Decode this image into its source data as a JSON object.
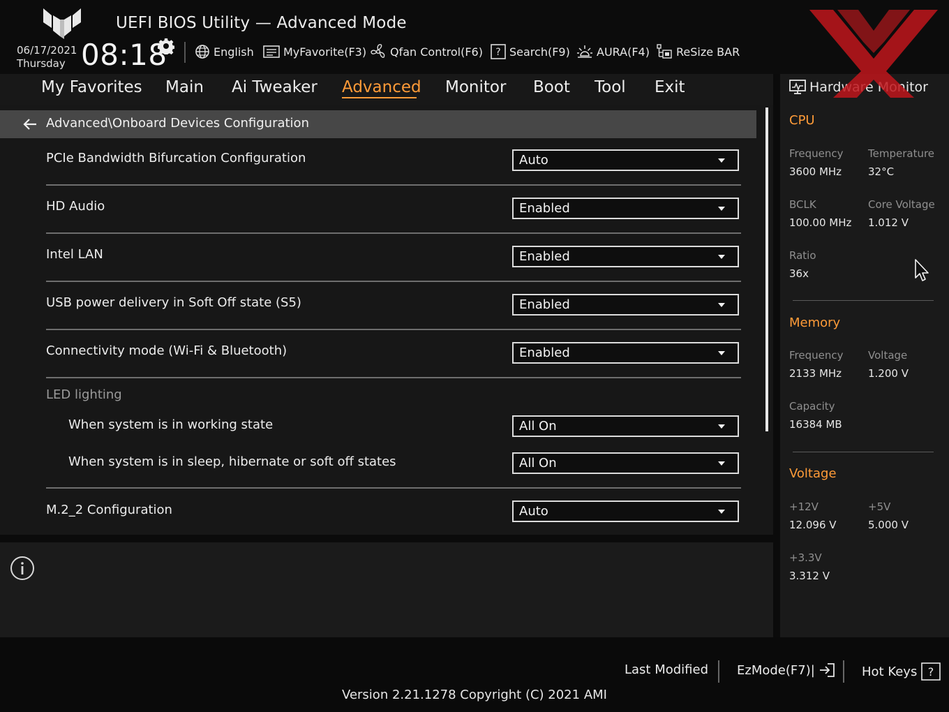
{
  "header": {
    "title": "UEFI BIOS Utility — Advanced Mode",
    "date": "06/17/2021",
    "day": "Thursday",
    "time": "08:18",
    "toolbar": [
      {
        "label": "English",
        "icon": "globe-icon"
      },
      {
        "label": "MyFavorite(F3)",
        "icon": "favorite-list-icon"
      },
      {
        "label": "Qfan Control(F6)",
        "icon": "fan-icon"
      },
      {
        "label": "Search(F9)",
        "icon": "help-search-icon"
      },
      {
        "label": "AURA(F4)",
        "icon": "aura-light-icon"
      },
      {
        "label": "ReSize BAR",
        "icon": "resize-bar-icon"
      }
    ]
  },
  "nav": {
    "tabs": [
      {
        "label": "My Favorites"
      },
      {
        "label": "Main"
      },
      {
        "label": "Ai Tweaker"
      },
      {
        "label": "Advanced",
        "active": true
      },
      {
        "label": "Monitor"
      },
      {
        "label": "Boot"
      },
      {
        "label": "Tool"
      },
      {
        "label": "Exit"
      }
    ]
  },
  "main": {
    "breadcrumb": "Advanced\\Onboard Devices Configuration",
    "settings": [
      {
        "label": "PCIe Bandwidth Bifurcation Configuration",
        "value": "Auto"
      },
      {
        "label": "HD Audio",
        "value": "Enabled"
      },
      {
        "label": "Intel LAN",
        "value": "Enabled"
      },
      {
        "label": "USB power delivery in Soft Off state (S5)",
        "value": "Enabled"
      },
      {
        "label": "Connectivity mode (Wi-Fi & Bluetooth)",
        "value": "Enabled"
      }
    ],
    "led_group": {
      "label": "LED lighting",
      "settings": [
        {
          "label": "When system is in working state",
          "value": "All On"
        },
        {
          "label": "When system is in sleep, hibernate or soft off states",
          "value": "All On"
        }
      ]
    },
    "m2_setting": {
      "label": "M.2_2 Configuration",
      "value": "Auto"
    }
  },
  "hw_monitor": {
    "title": "Hardware Monitor",
    "cpu": {
      "title": "CPU",
      "frequency_label": "Frequency",
      "frequency": "3600 MHz",
      "temperature_label": "Temperature",
      "temperature": "32°C",
      "bclk_label": "BCLK",
      "bclk": "100.00 MHz",
      "core_voltage_label": "Core Voltage",
      "core_voltage": "1.012 V",
      "ratio_label": "Ratio",
      "ratio": "36x"
    },
    "memory": {
      "title": "Memory",
      "frequency_label": "Frequency",
      "frequency": "2133 MHz",
      "voltage_label": "Voltage",
      "voltage": "1.200 V",
      "capacity_label": "Capacity",
      "capacity": "16384 MB"
    },
    "voltage": {
      "title": "Voltage",
      "v12_label": "+12V",
      "v12": "12.096 V",
      "v5_label": "+5V",
      "v5": "5.000 V",
      "v33_label": "+3.3V",
      "v33": "3.312 V"
    }
  },
  "footer": {
    "last_modified": "Last Modified",
    "ezmode": "EzMode(F7)|",
    "hot_keys": "Hot Keys",
    "hot_keys_glyph": "?",
    "version": "Version 2.21.1278 Copyright (C) 2021 AMI"
  },
  "colors": {
    "accent": "#ff9b38",
    "background": "#0b0b0b",
    "panel": "#171717",
    "breadcrumb_bar": "#474747",
    "watermark": "#c0161c"
  }
}
